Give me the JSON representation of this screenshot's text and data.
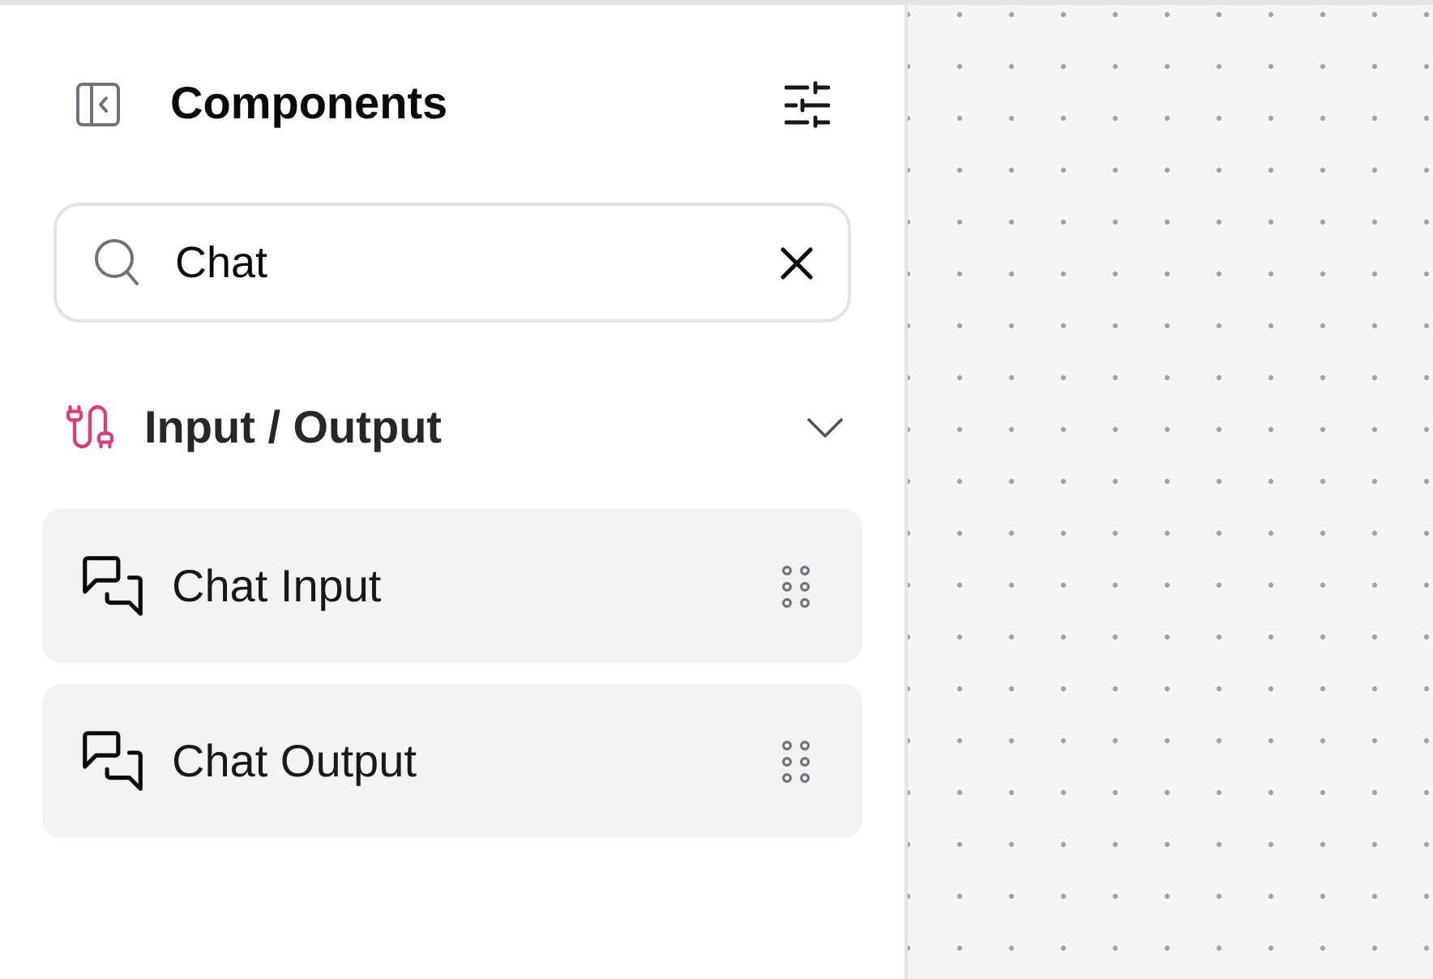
{
  "sidebar": {
    "title": "Components",
    "search": {
      "value": "Chat"
    },
    "sections": [
      {
        "title": "Input / Output",
        "expanded": true,
        "items": [
          {
            "label": "Chat Input"
          },
          {
            "label": "Chat Output"
          }
        ]
      }
    ]
  }
}
